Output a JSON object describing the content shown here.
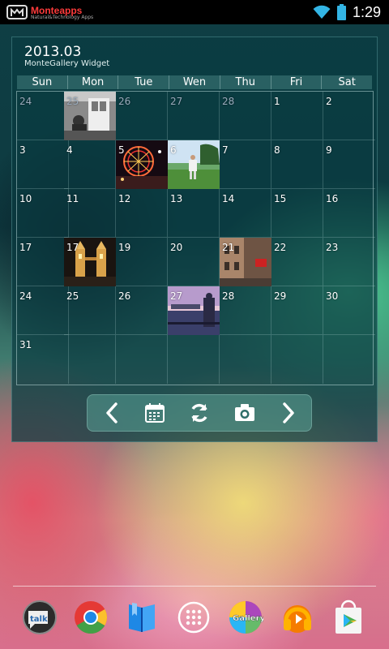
{
  "status_bar": {
    "brand": "Monteapps",
    "tagline": "Natural&Technology Apps",
    "time": "1:29",
    "icons": [
      "wifi-icon",
      "battery-icon"
    ]
  },
  "widget": {
    "date": "2013.03",
    "subtitle": "MonteGallery Widget",
    "weekdays": [
      "Sun",
      "Mon",
      "Tue",
      "Wen",
      "Thu",
      "Fri",
      "Sat"
    ],
    "weeks": [
      [
        "24",
        "25",
        "26",
        "27",
        "28",
        "1",
        "2"
      ],
      [
        "3",
        "4",
        "5",
        "6",
        "7",
        "8",
        "9"
      ],
      [
        "10",
        "11",
        "12",
        "13",
        "14",
        "15",
        "16"
      ],
      [
        "17",
        "17",
        "19",
        "20",
        "21",
        "22",
        "23"
      ],
      [
        "24",
        "25",
        "26",
        "27",
        "28",
        "29",
        "30"
      ],
      [
        "31",
        "",
        "",
        "",
        "",
        "",
        ""
      ]
    ],
    "controls": [
      "prev-icon",
      "calendar-icon",
      "refresh-icon",
      "camera-icon",
      "next-icon"
    ]
  },
  "dock": {
    "apps": [
      "Talk",
      "Chrome",
      "Books",
      "App drawer",
      "Gallery",
      "Play Music",
      "Play Store"
    ],
    "talk_label": "talk",
    "gallery_label": "Gallery"
  },
  "colors": {
    "status_bar": "#000000",
    "widget_bg": "#0a3c41",
    "brand_red": "#ff3b3b",
    "grid_line": "#c8e6e6"
  }
}
